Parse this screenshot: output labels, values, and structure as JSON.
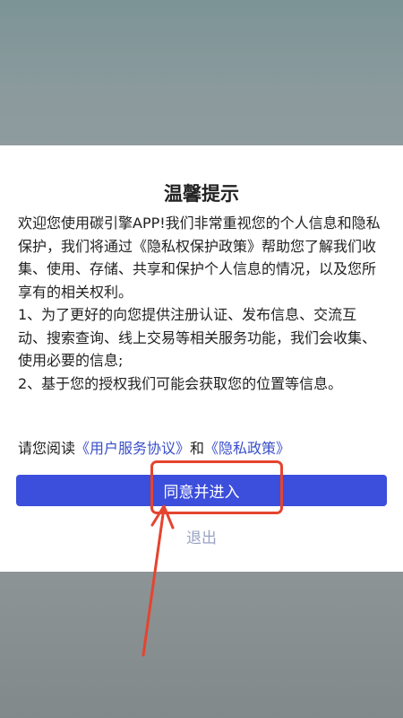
{
  "dialog": {
    "title": "温馨提示",
    "paragraphs": [
      "欢迎您使用碳引擎APP!我们非常重视您的个人信息和隐私保护，我们将通过《隐私权保护政策》帮助您了解我们收集、使用、存储、共享和保护个人信息的情况，以及您所享有的相关权利。",
      " 1、为了更好的向您提供注册认证、发布信息、交流互动、搜索查询、线上交易等相关服务功能，我们会收集、使用必要的信息;",
      " 2、基于您的授权我们可能会获取您的位置等信息。"
    ],
    "read_prefix": "请您阅读",
    "user_agreement_link": "《用户服务协议》",
    "and_text": "和",
    "privacy_policy_link": "《隐私政策》",
    "agree_button": "同意并进入",
    "exit_button": "退出"
  },
  "colors": {
    "primary_button": "#3b4edc",
    "link": "#3a4fc9",
    "annotation": "#e5442f"
  }
}
